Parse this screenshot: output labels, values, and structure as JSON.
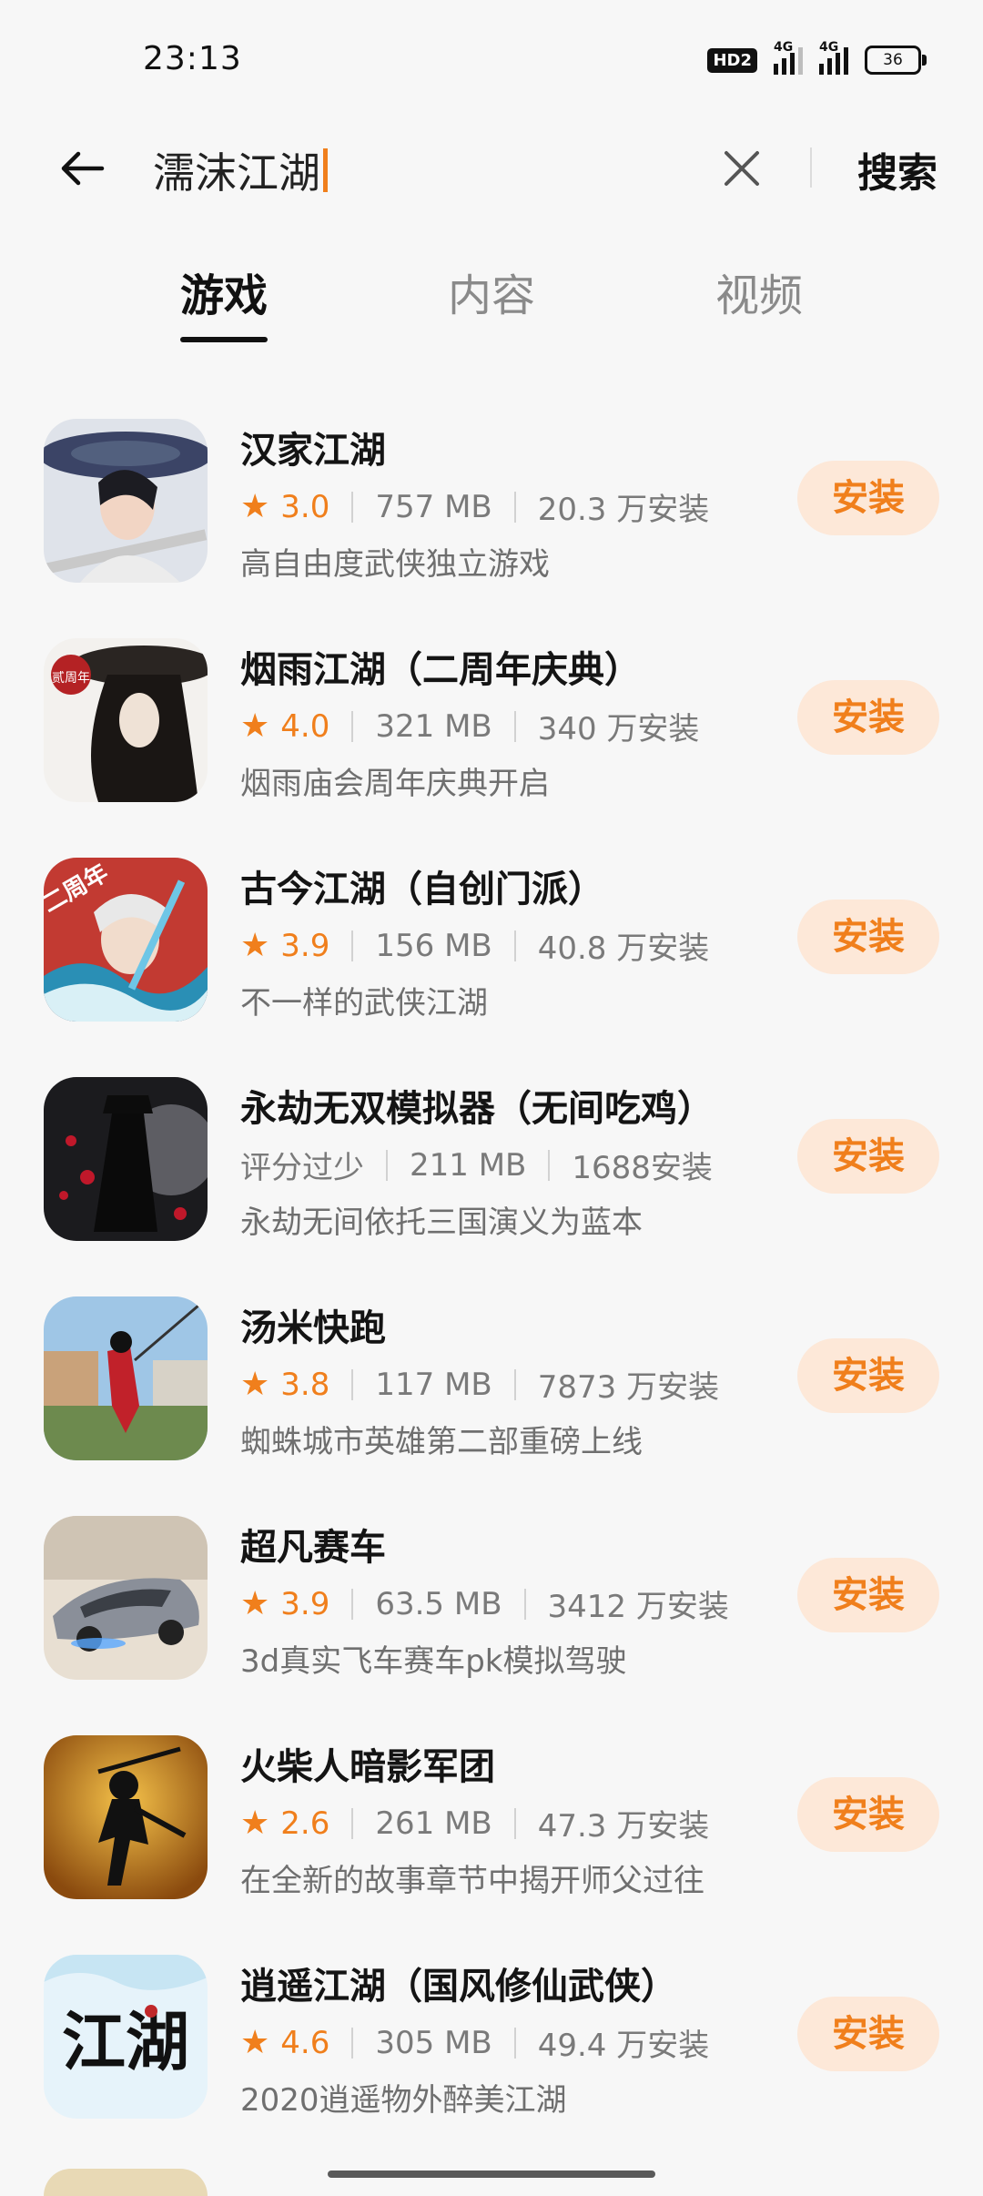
{
  "status_bar": {
    "time": "23:13",
    "hd_label": "HD2",
    "signal1_label": "4G",
    "signal2_label": "4G",
    "battery": "36"
  },
  "search": {
    "query": "濡沫江湖",
    "search_button": "搜索"
  },
  "tabs": [
    {
      "label": "游戏",
      "active": true
    },
    {
      "label": "内容",
      "active": false
    },
    {
      "label": "视频",
      "active": false
    }
  ],
  "apps": [
    {
      "name": "汉家江湖",
      "rating": "3.0",
      "size": "757 MB",
      "installs": "20.3 万安装",
      "desc": "高自由度武侠独立游戏",
      "install_label": "安装"
    },
    {
      "name": "烟雨江湖（二周年庆典）",
      "rating": "4.0",
      "size": "321 MB",
      "installs": "340 万安装",
      "desc": "烟雨庙会周年庆典开启",
      "install_label": "安装"
    },
    {
      "name": "古今江湖（自创门派）",
      "rating": "3.9",
      "size": "156 MB",
      "installs": "40.8 万安装",
      "desc": "不一样的武侠江湖",
      "install_label": "安装"
    },
    {
      "name": "永劫无双模拟器（无间吃鸡）",
      "rating_text": "评分过少",
      "size": "211 MB",
      "installs": "1688安装",
      "desc": "永劫无间依托三国演义为蓝本",
      "install_label": "安装"
    },
    {
      "name": "汤米快跑",
      "rating": "3.8",
      "size": "117 MB",
      "installs": "7873 万安装",
      "desc": "蜘蛛城市英雄第二部重磅上线",
      "install_label": "安装"
    },
    {
      "name": "超凡赛车",
      "rating": "3.9",
      "size": "63.5 MB",
      "installs": "3412 万安装",
      "desc": "3d真实飞车赛车pk模拟驾驶",
      "install_label": "安装"
    },
    {
      "name": "火柴人暗影军团",
      "rating": "2.6",
      "size": "261 MB",
      "installs": "47.3 万安装",
      "desc": "在全新的故事章节中揭开师父过往",
      "install_label": "安装"
    },
    {
      "name": "逍遥江湖（国风修仙武侠）",
      "rating": "4.6",
      "size": "305 MB",
      "installs": "49.4 万安装",
      "desc": "2020逍遥物外醉美江湖",
      "install_label": "安装"
    }
  ],
  "icon_text": {
    "app2": "贰周年",
    "app3": "二周年",
    "app8": "江湖"
  },
  "colors": {
    "accent": "#f07f1c",
    "install_bg": "#fde8d8"
  }
}
